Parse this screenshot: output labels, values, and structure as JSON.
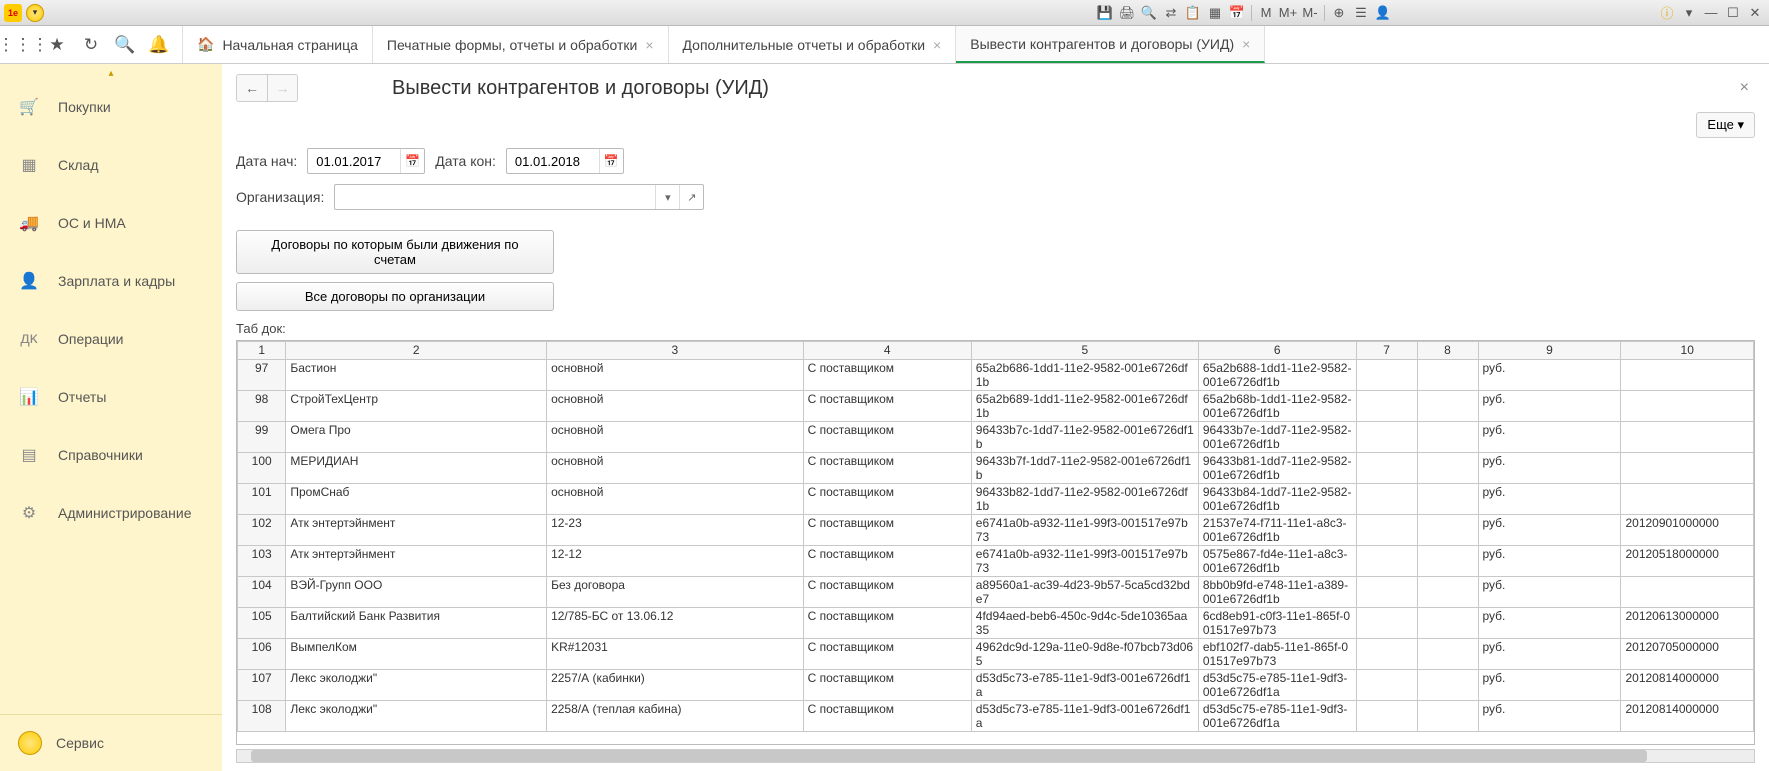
{
  "titlebar": {
    "m_labels": [
      "M",
      "M+",
      "M-"
    ]
  },
  "tabs": {
    "home": "Начальная страница",
    "t1": "Печатные формы, отчеты и обработки",
    "t2": "Дополнительные отчеты и обработки",
    "t3": "Вывести контрагентов и договоры (УИД)"
  },
  "sidebar": {
    "items": [
      {
        "label": "Покупки"
      },
      {
        "label": "Склад"
      },
      {
        "label": "ОС и НМА"
      },
      {
        "label": "Зарплата и кадры"
      },
      {
        "label": "Операции"
      },
      {
        "label": "Отчеты"
      },
      {
        "label": "Справочники"
      },
      {
        "label": "Администрирование"
      }
    ],
    "service": "Сервис"
  },
  "page": {
    "title": "Вывести контрагентов и договоры (УИД)",
    "more": "Еще ▾"
  },
  "filters": {
    "date_start_label": "Дата нач:",
    "date_start": "01.01.2017",
    "date_end_label": "Дата кон:",
    "date_end": "01.01.2018",
    "org_label": "Организация:",
    "org_value": ""
  },
  "actions": {
    "btn1": "Договоры по которым были движения по счетам",
    "btn2": "Все договоры по организации"
  },
  "table_label": "Таб док:",
  "columns": [
    "1",
    "2",
    "3",
    "4",
    "5",
    "6",
    "7",
    "8",
    "9",
    "10"
  ],
  "rows": [
    {
      "n": "97",
      "c2": "Бастион",
      "c3": "основной",
      "c4": "С поставщиком",
      "c5": "65a2b686-1dd1-11e2-9582-001e6726df1b",
      "c6": "65a2b688-1dd1-11e2-9582-001e6726df1b",
      "c7": "",
      "c8": "",
      "c9": "руб.",
      "c10": ""
    },
    {
      "n": "98",
      "c2": "СтройТехЦентр",
      "c3": "основной",
      "c4": "С поставщиком",
      "c5": "65a2b689-1dd1-11e2-9582-001e6726df1b",
      "c6": "65a2b68b-1dd1-11e2-9582-001e6726df1b",
      "c7": "",
      "c8": "",
      "c9": "руб.",
      "c10": ""
    },
    {
      "n": "99",
      "c2": "Омега Про",
      "c3": "основной",
      "c4": "С поставщиком",
      "c5": "96433b7c-1dd7-11e2-9582-001e6726df1b",
      "c6": "96433b7e-1dd7-11e2-9582-001e6726df1b",
      "c7": "",
      "c8": "",
      "c9": "руб.",
      "c10": ""
    },
    {
      "n": "100",
      "c2": "МЕРИДИАН",
      "c3": "основной",
      "c4": "С поставщиком",
      "c5": "96433b7f-1dd7-11e2-9582-001e6726df1b",
      "c6": "96433b81-1dd7-11e2-9582-001e6726df1b",
      "c7": "",
      "c8": "",
      "c9": "руб.",
      "c10": ""
    },
    {
      "n": "101",
      "c2": "ПромСнаб",
      "c3": "основной",
      "c4": "С поставщиком",
      "c5": "96433b82-1dd7-11e2-9582-001e6726df1b",
      "c6": "96433b84-1dd7-11e2-9582-001e6726df1b",
      "c7": "",
      "c8": "",
      "c9": "руб.",
      "c10": ""
    },
    {
      "n": "102",
      "c2": "Атк энтертэйнмент",
      "c3": "12-23",
      "c4": "С поставщиком",
      "c5": "e6741a0b-a932-11e1-99f3-001517e97b73",
      "c6": "21537e74-f711-11e1-a8c3-001e6726df1b",
      "c7": "",
      "c8": "",
      "c9": "руб.",
      "c10": "20120901000000"
    },
    {
      "n": "103",
      "c2": "Атк энтертэйнмент",
      "c3": "12-12",
      "c4": "С поставщиком",
      "c5": "e6741a0b-a932-11e1-99f3-001517e97b73",
      "c6": "0575e867-fd4e-11e1-a8c3-001e6726df1b",
      "c7": "",
      "c8": "",
      "c9": "руб.",
      "c10": "20120518000000"
    },
    {
      "n": "104",
      "c2": "ВЭЙ-Групп ООО",
      "c3": "Без договора",
      "c4": "С поставщиком",
      "c5": "a89560a1-ac39-4d23-9b57-5ca5cd32bde7",
      "c6": "8bb0b9fd-e748-11e1-a389-001e6726df1b",
      "c7": "",
      "c8": "",
      "c9": "руб.",
      "c10": ""
    },
    {
      "n": "105",
      "c2": "Балтийский Банк Развития",
      "c3": "12/785-БС от 13.06.12",
      "c4": "С поставщиком",
      "c5": "4fd94aed-beb6-450c-9d4c-5de10365aa35",
      "c6": "6cd8eb91-c0f3-11e1-865f-001517e97b73",
      "c7": "",
      "c8": "",
      "c9": "руб.",
      "c10": "20120613000000"
    },
    {
      "n": "106",
      "c2": "ВымпелКом",
      "c3": "KR#12031",
      "c4": "С поставщиком",
      "c5": "4962dc9d-129a-11e0-9d8e-f07bcb73d065",
      "c6": "ebf102f7-dab5-11e1-865f-001517e97b73",
      "c7": "",
      "c8": "",
      "c9": "руб.",
      "c10": "20120705000000"
    },
    {
      "n": "107",
      "c2": "Лекс эколоджи\"",
      "c3": "2257/А (кабинки)",
      "c4": "С поставщиком",
      "c5": "d53d5c73-e785-11e1-9df3-001e6726df1a",
      "c6": "d53d5c75-e785-11e1-9df3-001e6726df1a",
      "c7": "",
      "c8": "",
      "c9": "руб.",
      "c10": "20120814000000"
    },
    {
      "n": "108",
      "c2": "Лекс эколоджи\"",
      "c3": "2258/А (теплая кабина)",
      "c4": "С поставщиком",
      "c5": "d53d5c73-e785-11e1-9df3-001e6726df1a",
      "c6": "d53d5c75-e785-11e1-9df3-001e6726df1a",
      "c7": "",
      "c8": "",
      "c9": "руб.",
      "c10": "20120814000000"
    }
  ]
}
